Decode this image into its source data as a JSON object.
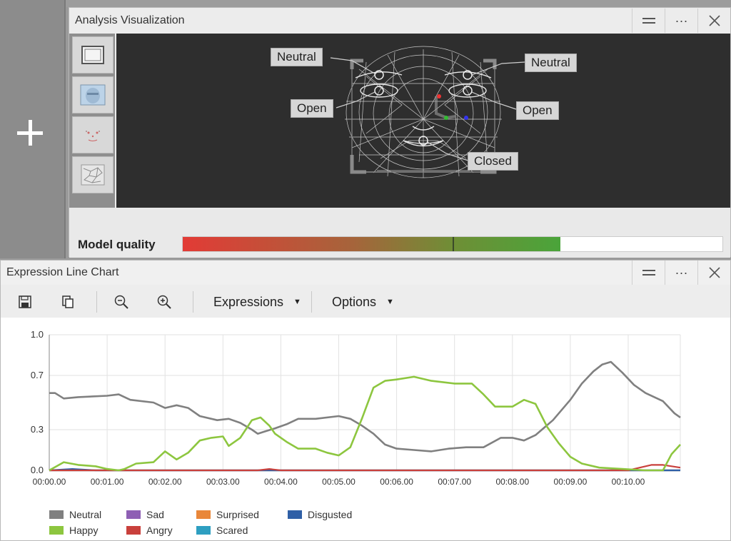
{
  "analysis_panel": {
    "title": "Analysis Visualization",
    "face_labels": {
      "left_brow": "Neutral",
      "right_brow": "Neutral",
      "left_eye": "Open",
      "right_eye": "Open",
      "mouth": "Closed"
    },
    "model_quality_label": "Model quality",
    "model_quality_value": 0.7
  },
  "chart_panel": {
    "title": "Expression Line Chart",
    "toolbar": {
      "expressions_label": "Expressions",
      "options_label": "Options"
    }
  },
  "window_buttons": {
    "more": "···"
  },
  "colors": {
    "neutral": "#808080",
    "happy": "#8dc63f",
    "sad": "#8e5fb4",
    "angry": "#c9403c",
    "surprised": "#e9873a",
    "scared": "#2e9fc1",
    "disgusted": "#2f5fa6"
  },
  "chart_data": {
    "type": "line",
    "title": "",
    "xlabel": "",
    "ylabel": "",
    "ylim": [
      0.0,
      1.0
    ],
    "y_tick_labels": [
      "1.0",
      "0.7",
      "0.3",
      "0.0"
    ],
    "y_ticks": [
      1.0,
      0.7,
      0.3,
      0.0
    ],
    "x_tick_labels": [
      "00:00.00",
      "00:01.00",
      "00:02.00",
      "00:03.00",
      "00:04.00",
      "00:05.00",
      "00:06.00",
      "00:07.00",
      "00:08.00",
      "00:09.00",
      "00:10.00"
    ],
    "x_unit": "minutes",
    "xlim": [
      0,
      10.9
    ],
    "grid": true,
    "legend_position": "bottom-left",
    "series": [
      {
        "name": "Neutral",
        "color_key": "neutral",
        "x": [
          0,
          0.1,
          0.25,
          0.5,
          1.0,
          1.2,
          1.4,
          1.8,
          2.0,
          2.2,
          2.4,
          2.6,
          2.9,
          3.1,
          3.3,
          3.5,
          3.6,
          3.75,
          3.9,
          4.1,
          4.3,
          4.6,
          5.0,
          5.2,
          5.4,
          5.6,
          5.8,
          6.0,
          6.3,
          6.6,
          6.9,
          7.2,
          7.5,
          7.8,
          8.0,
          8.2,
          8.4,
          8.7,
          9.0,
          9.2,
          9.4,
          9.55,
          9.7,
          9.9,
          10.1,
          10.3,
          10.6,
          10.8,
          10.9
        ],
        "values": [
          0.57,
          0.57,
          0.53,
          0.54,
          0.55,
          0.56,
          0.52,
          0.5,
          0.46,
          0.48,
          0.46,
          0.4,
          0.37,
          0.38,
          0.35,
          0.3,
          0.27,
          0.29,
          0.31,
          0.34,
          0.38,
          0.38,
          0.4,
          0.38,
          0.33,
          0.27,
          0.19,
          0.16,
          0.15,
          0.14,
          0.16,
          0.17,
          0.17,
          0.24,
          0.24,
          0.22,
          0.26,
          0.37,
          0.52,
          0.64,
          0.73,
          0.78,
          0.8,
          0.72,
          0.63,
          0.57,
          0.51,
          0.42,
          0.39
        ]
      },
      {
        "name": "Happy",
        "color_key": "happy",
        "x": [
          0,
          0.25,
          0.5,
          0.8,
          1.0,
          1.2,
          1.3,
          1.5,
          1.8,
          2.0,
          2.2,
          2.4,
          2.6,
          2.8,
          3.0,
          3.1,
          3.3,
          3.5,
          3.65,
          3.8,
          3.9,
          4.1,
          4.3,
          4.6,
          4.8,
          5.0,
          5.2,
          5.4,
          5.6,
          5.8,
          6.0,
          6.3,
          6.6,
          7.0,
          7.3,
          7.5,
          7.7,
          8.0,
          8.2,
          8.4,
          8.6,
          8.8,
          9.0,
          9.2,
          9.5,
          9.9,
          10.3,
          10.6,
          10.75,
          10.9
        ],
        "values": [
          0.0,
          0.06,
          0.04,
          0.03,
          0.01,
          0.0,
          0.01,
          0.05,
          0.06,
          0.14,
          0.08,
          0.13,
          0.22,
          0.24,
          0.25,
          0.18,
          0.24,
          0.37,
          0.39,
          0.33,
          0.27,
          0.21,
          0.16,
          0.16,
          0.13,
          0.11,
          0.17,
          0.38,
          0.61,
          0.66,
          0.67,
          0.69,
          0.66,
          0.64,
          0.64,
          0.56,
          0.47,
          0.47,
          0.52,
          0.49,
          0.32,
          0.2,
          0.1,
          0.05,
          0.02,
          0.01,
          0.0,
          0.0,
          0.12,
          0.19
        ]
      },
      {
        "name": "Angry",
        "color_key": "angry",
        "x": [
          0,
          3.6,
          3.8,
          4.0,
          10.0,
          10.2,
          10.4,
          10.6,
          10.9
        ],
        "values": [
          0.0,
          0.0,
          0.01,
          0.0,
          0.0,
          0.02,
          0.04,
          0.04,
          0.02
        ]
      },
      {
        "name": "Sad",
        "color_key": "sad",
        "x": [
          0,
          10.9
        ],
        "values": [
          0.0,
          0.0
        ]
      },
      {
        "name": "Surprised",
        "color_key": "surprised",
        "x": [
          0,
          10.9
        ],
        "values": [
          0.0,
          0.0
        ]
      },
      {
        "name": "Scared",
        "color_key": "scared",
        "x": [
          0,
          10.9
        ],
        "values": [
          0.0,
          0.0
        ]
      },
      {
        "name": "Disgusted",
        "color_key": "disgusted",
        "x": [
          0,
          0.4,
          0.8,
          10.0,
          10.9
        ],
        "values": [
          0.0,
          0.01,
          0.0,
          0.0,
          0.0
        ]
      }
    ],
    "legend": [
      {
        "label": "Neutral",
        "color_key": "neutral"
      },
      {
        "label": "Sad",
        "color_key": "sad"
      },
      {
        "label": "Surprised",
        "color_key": "surprised"
      },
      {
        "label": "Disgusted",
        "color_key": "disgusted"
      },
      {
        "label": "Happy",
        "color_key": "happy"
      },
      {
        "label": "Angry",
        "color_key": "angry"
      },
      {
        "label": "Scared",
        "color_key": "scared"
      }
    ]
  }
}
